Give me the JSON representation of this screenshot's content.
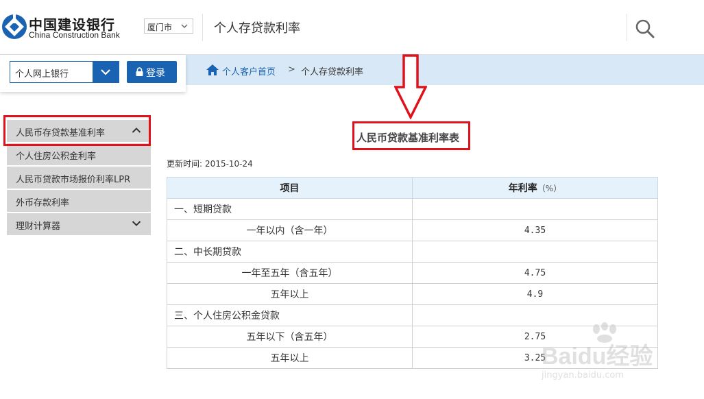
{
  "header": {
    "logo_cn": "中国建设银行",
    "logo_en": "China Construction Bank",
    "city": "厦门市",
    "title": "个人存贷款利率"
  },
  "login": {
    "bank_type": "个人网上银行",
    "login_label": "登录"
  },
  "breadcrumb": {
    "home": "个人客户首页",
    "separator": ">",
    "current": "个人存贷款利率"
  },
  "sidebar": {
    "items": [
      {
        "label": "人民币存贷款基准利率",
        "expanded": true
      },
      {
        "label": "个人住房公积金利率"
      },
      {
        "label": "人民币贷款市场报价利率LPR"
      },
      {
        "label": "外币存款利率"
      },
      {
        "label": "理财计算器",
        "expanded": false
      }
    ]
  },
  "main": {
    "table_title": "人民币贷款基准利率表",
    "update_label": "更新时间:",
    "update_value": "2015-10-24",
    "columns": [
      "项目",
      "年利率",
      "（%）"
    ],
    "rows": [
      {
        "item": "一、短期贷款",
        "rate": ""
      },
      {
        "item": "一年以内（含一年）",
        "rate": "4.35"
      },
      {
        "item": "二、中长期贷款",
        "rate": ""
      },
      {
        "item": "一年至五年（含五年）",
        "rate": "4.75"
      },
      {
        "item": "五年以上",
        "rate": "4.9"
      },
      {
        "item": "三、个人住房公积金贷款",
        "rate": ""
      },
      {
        "item": "五年以下（含五年）",
        "rate": "2.75"
      },
      {
        "item": "五年以上",
        "rate": "3.25"
      }
    ]
  },
  "watermark": {
    "logo": "Baidu经验",
    "url": "jingyan.baidu.com"
  },
  "colors": {
    "brand_blue": "#1a63b3",
    "highlight_red": "#e0111b",
    "breadcrumb_bg": "#d9e8f6",
    "sidebar_bg": "#d6d6d6",
    "table_header_bg": "#e5f1fb"
  }
}
